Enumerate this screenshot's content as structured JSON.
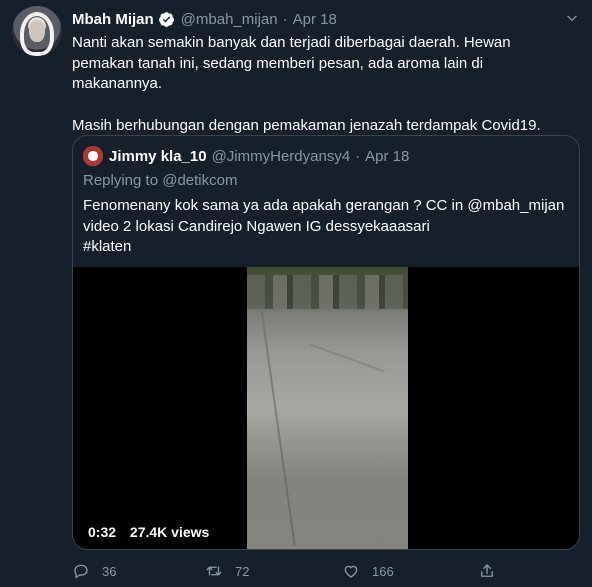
{
  "tweet": {
    "author_name": "Mbah Mijan",
    "author_handle": "@mbah_mijan",
    "separator": "·",
    "date": "Apr 18",
    "text_lines": [
      "Nanti akan semakin banyak dan terjadi diberbagai daerah. Hewan",
      "pemakan tanah ini, sedang memberi pesan, ada aroma lain di",
      "makanannya."
    ],
    "text_line2": "Masih berhubungan dengan pemakaman jenazah terdampak Covid19."
  },
  "quoted": {
    "author_name": "Jimmy kla_10",
    "author_handle": "@JimmyHerdyansy4",
    "separator": "·",
    "date": "Apr 18",
    "replying_to": "Replying to @detikcom",
    "text_lines": [
      "Fenomenany kok sama ya ada apakah gerangan ? CC in @mbah_mijan",
      "video 2 lokasi Candirejo Ngawen IG dessyekaaasari",
      "#klaten"
    ],
    "video": {
      "duration": "0:32",
      "views": "27.4K views"
    }
  },
  "actions": {
    "reply_count": "36",
    "retweet_count": "72",
    "like_count": "166"
  },
  "icons": {
    "verified": "verified-badge-icon",
    "caret": "chevron-down-icon",
    "reply": "reply-icon",
    "retweet": "retweet-icon",
    "like": "like-icon",
    "share": "share-icon"
  },
  "colors": {
    "background": "#15202b",
    "muted": "#8899a6",
    "border": "#38444d",
    "verified": "#ffffff"
  }
}
